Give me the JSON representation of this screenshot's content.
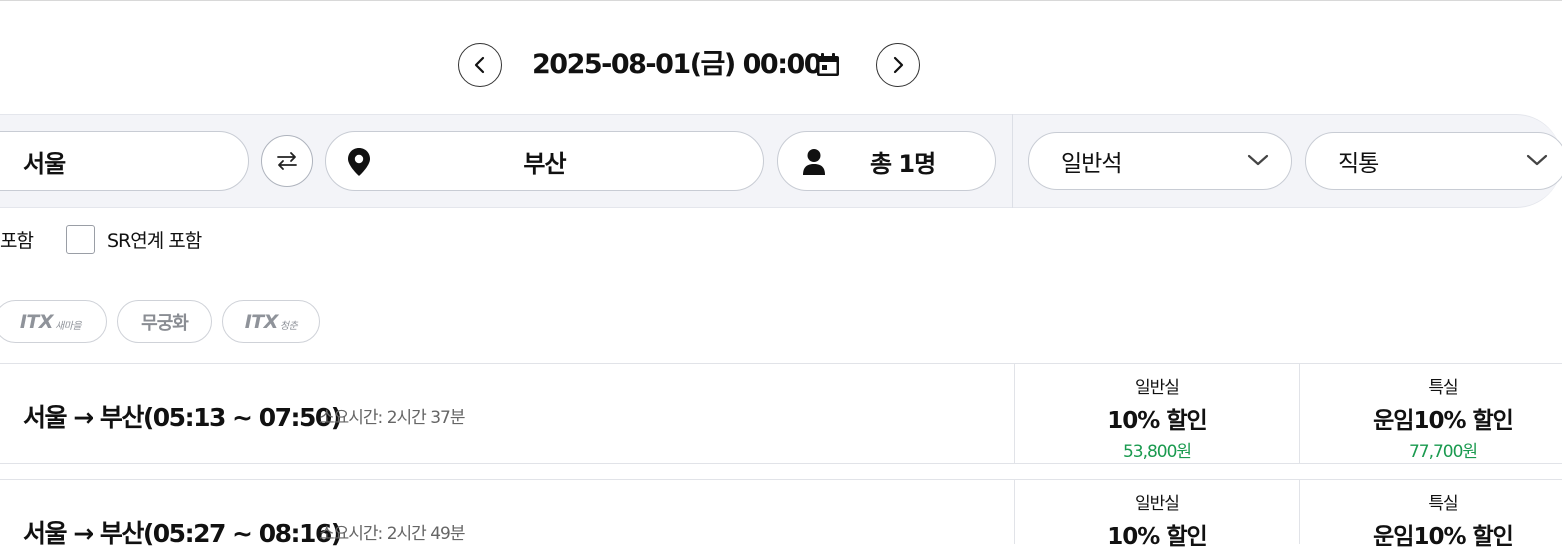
{
  "date_bar": {
    "datetime": "2025-08-01(금) 00:00",
    "prev_label": "<",
    "next_label": ">"
  },
  "search": {
    "departure": "서울",
    "arrival": "부산",
    "passengers": "총 1명",
    "seat_class": "일반석",
    "route_type": "직통"
  },
  "options": {
    "partial_label": "포함",
    "sr_label": "SR연계 포함",
    "sr_checked": false
  },
  "train_filters": [
    {
      "big": "ITX",
      "small": "새마을"
    },
    {
      "label": "무궁화"
    },
    {
      "big": "ITX",
      "small": "청춘"
    }
  ],
  "results": [
    {
      "title": "서울 → 부산(05:13 ~ 07:50)",
      "duration": "소요시간: 2시간 37분",
      "general": {
        "class": "일반실",
        "discount": "10% 할인",
        "price": "53,800원"
      },
      "special": {
        "class": "특실",
        "discount": "운임10% 할인",
        "price": "77,700원"
      }
    },
    {
      "title": "서울 → 부산(05:27 ~ 08:16)",
      "duration": "소요시간: 2시간 49분",
      "general": {
        "class": "일반실",
        "discount": "10% 할인"
      },
      "special": {
        "class": "특실",
        "discount": "운임10% 할인"
      }
    }
  ],
  "colors": {
    "price_green": "#1a9a4f",
    "strip_bg": "#f3f4f8"
  }
}
